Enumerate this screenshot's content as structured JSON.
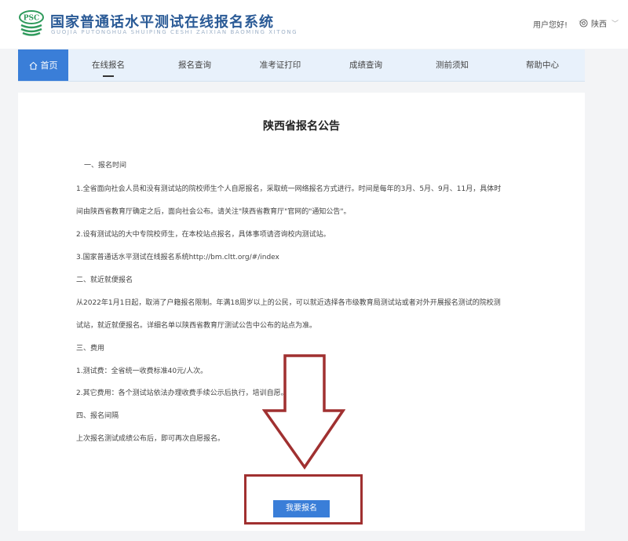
{
  "header": {
    "logo_text": "PSC",
    "title": "国家普通话水平测试在线报名系统",
    "subtitle": "GUOJIA PUTONGHUA SHUIPING CESHI ZAIXIAN BAOMING XITONG",
    "user_greeting": "用户您好!",
    "location": "陕西"
  },
  "nav": {
    "home": "首页",
    "items": [
      "在线报名",
      "报名查询",
      "准考证打印",
      "成绩查询",
      "测前须知",
      "帮助中心"
    ],
    "active_index": 0
  },
  "notice": {
    "title": "陕西省报名公告",
    "lines": [
      "一、报名时间",
      "1.全省面向社会人员和没有测试站的院校师生个人自愿报名，采取统一网络报名方式进行。时间是每年的3月、5月、9月、11月，具体时",
      "间由陕西省教育厅确定之后，面向社会公布。请关注\"陕西省教育厅\"官网的\"通知公告\"。",
      "2.设有测试站的大中专院校师生，在本校站点报名，具体事项请咨询校内测试站。",
      "3.国家普通话水平测试在线报名系统http://bm.cltt.org/#/index",
      "二、就近就便报名",
      "从2022年1月1日起，取消了户籍报名限制。年满18周岁以上的公民，可以就近选择各市级教育局测试站或者对外开展报名测试的院校测",
      "试站，就近就便报名。详细名单以陕西省教育厅测试公告中公布的站点为准。",
      "三、费用",
      "1.测试费：全省统一收费标准40元/人次。",
      "2.其它费用：各个测试站依法办理收费手续公示后执行，培训自愿。",
      "四、报名间隔",
      "上次报名测试成绩公布后，即可再次自愿报名。"
    ],
    "apply_button": "我要报名"
  },
  "colors": {
    "brand_blue": "#3a7ed8",
    "nav_bg": "#e8f1fb",
    "title_blue": "#2a5a96",
    "logo_green": "#2f9a5c",
    "annotation_red": "#a03030"
  }
}
